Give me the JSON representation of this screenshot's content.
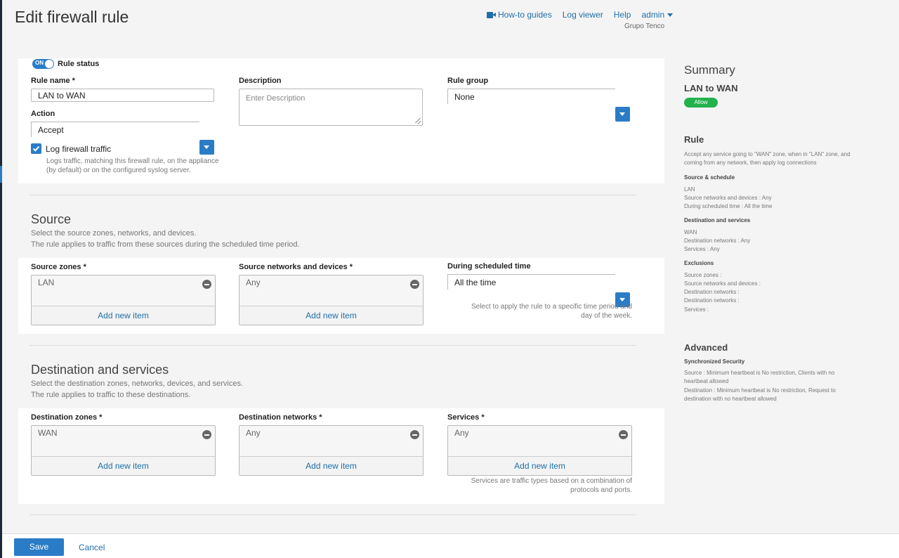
{
  "page": {
    "title": "Edit firewall rule"
  },
  "header": {
    "how_to": "How-to guides",
    "log_viewer": "Log viewer",
    "help": "Help",
    "admin": "admin",
    "org": "Grupo Tenco"
  },
  "rule": {
    "status_label": "Rule status",
    "status_on": "ON",
    "name_label": "Rule name *",
    "name_value": "LAN to WAN",
    "description_label": "Description",
    "description_placeholder": "Enter Description",
    "group_label": "Rule group",
    "group_value": "None",
    "action_label": "Action",
    "action_value": "Accept",
    "log_label": "Log firewall traffic",
    "log_checked": true,
    "log_help": "Logs traffic, matching this firewall rule, on the appliance (by default) or on the configured syslog server."
  },
  "source": {
    "title": "Source",
    "desc1": "Select the source zones, networks, and devices.",
    "desc2": "The rule applies to traffic from these sources during the scheduled time period.",
    "zones_label": "Source zones *",
    "zones_item": "LAN",
    "networks_label": "Source networks and devices *",
    "networks_item": "Any",
    "schedule_label": "During scheduled time",
    "schedule_value": "All the time",
    "schedule_help": "Select to apply the rule to a specific time period and day of the week.",
    "add_item": "Add new item"
  },
  "destination": {
    "title": "Destination and services",
    "desc1": "Select the destination zones, networks, devices, and services.",
    "desc2": "The rule applies to traffic to these destinations.",
    "zones_label": "Destination zones *",
    "zones_item": "WAN",
    "networks_label": "Destination networks *",
    "networks_item": "Any",
    "services_label": "Services *",
    "services_item": "Any",
    "services_help": "Services are traffic types based on a combination of protocols and ports.",
    "add_item": "Add new item"
  },
  "summary": {
    "title": "Summary",
    "name": "LAN to WAN",
    "badge": "Allow",
    "badge_color": "#22b24c",
    "rule_title": "Rule",
    "rule_desc": "Accept any service going to \"WAN\" zone, when in \"LAN\" zone, and coming from any network, then apply log connections",
    "source_title": "Source & schedule",
    "source_lines": [
      "LAN",
      "Source networks and devices : Any",
      "During scheduled time : All the time"
    ],
    "dest_title": "Destination and services",
    "dest_lines": [
      "WAN",
      "Destination networks : Any",
      "Services : Any"
    ],
    "excl_title": "Exclusions",
    "excl_lines": [
      "Source zones :",
      "Source networks and devices :",
      "Destination networks :",
      "Destination networks :",
      "Services :"
    ],
    "advanced_title": "Advanced",
    "sync_title": "Synchronized Security",
    "sync_source": "Source : Minimum heartbeat is No restriction, Clients with no heartbeat allowed",
    "sync_dest": "Destination : Minimum heartbeat is No restriction, Request to destination with no heartbeat allowed"
  },
  "footer": {
    "save": "Save",
    "cancel": "Cancel"
  },
  "colors": {
    "accent": "#2a7cc7",
    "link": "#1f6fa8",
    "allow": "#22b24c"
  }
}
